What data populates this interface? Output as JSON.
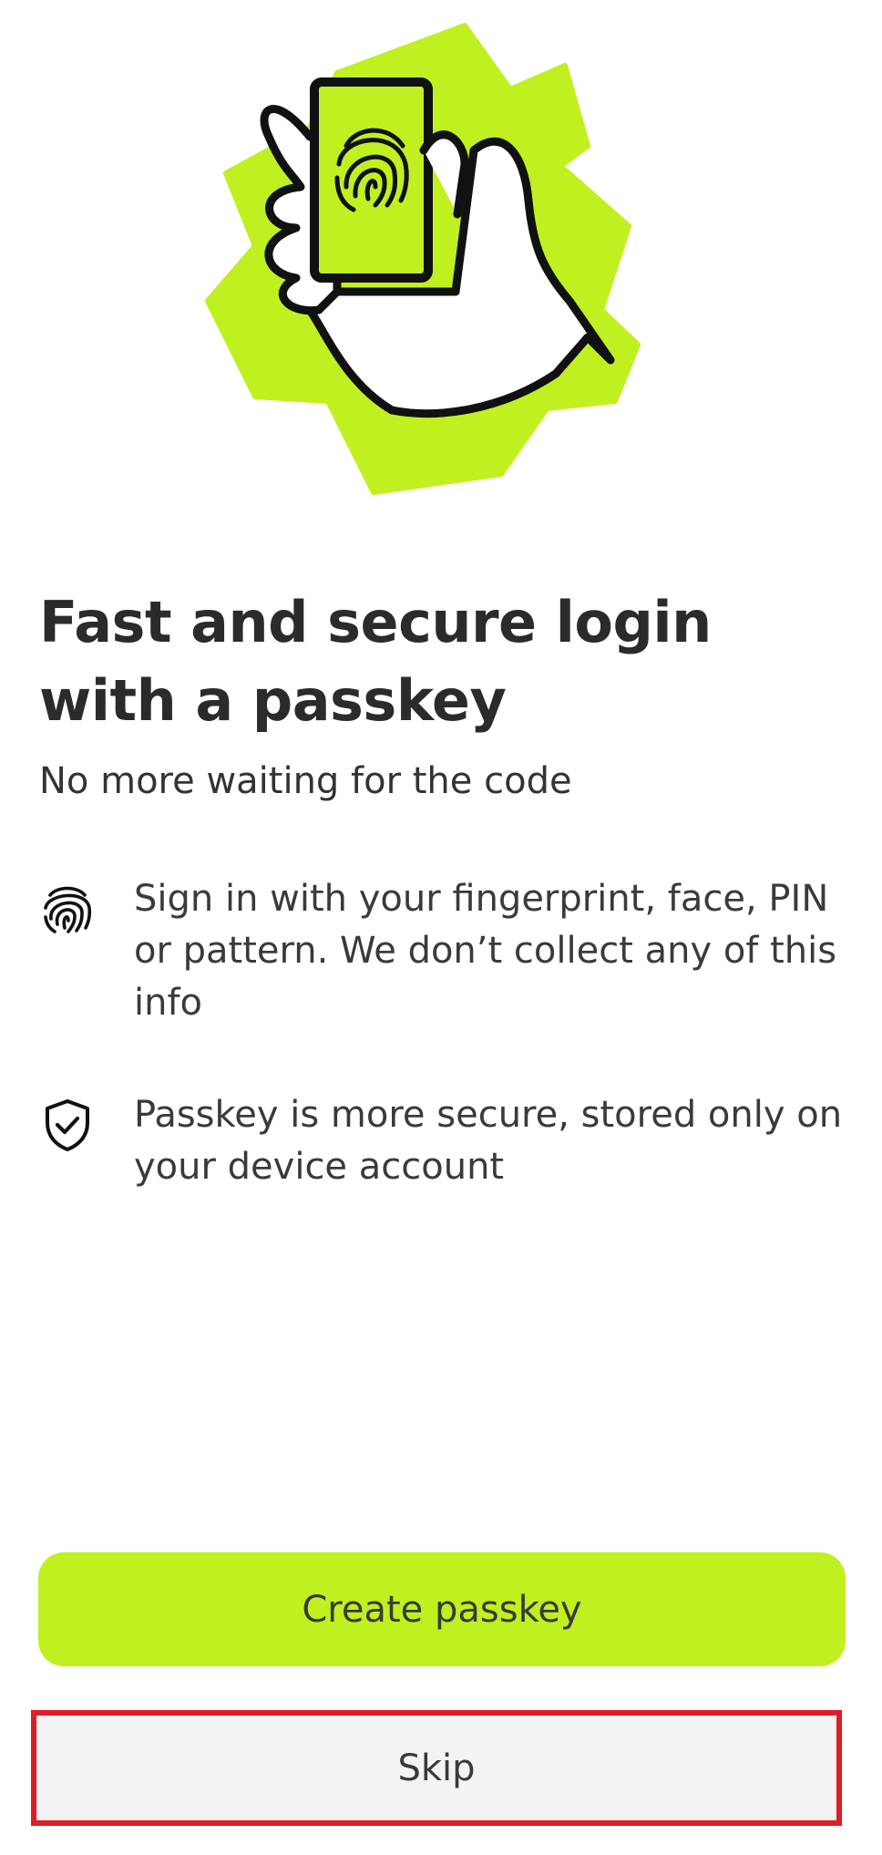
{
  "colors": {
    "accent": "#c0f01f",
    "skip_background": "#f3f3f3",
    "highlight_border": "#e01c24",
    "text": "#2b2b2b"
  },
  "hero": {
    "illustration": "hand-holding-phone-fingerprint"
  },
  "content": {
    "title": "Fast and secure login with a passkey",
    "subtitle": "No more waiting for the code",
    "features": [
      {
        "icon": "fingerprint-icon",
        "text": "Sign in with your fingerprint, face, PIN or pattern. We don’t collect any of this info"
      },
      {
        "icon": "shield-check-icon",
        "text": "Passkey is more secure, stored only on your device account"
      }
    ]
  },
  "actions": {
    "create_label": "Create passkey",
    "skip_label": "Skip"
  }
}
